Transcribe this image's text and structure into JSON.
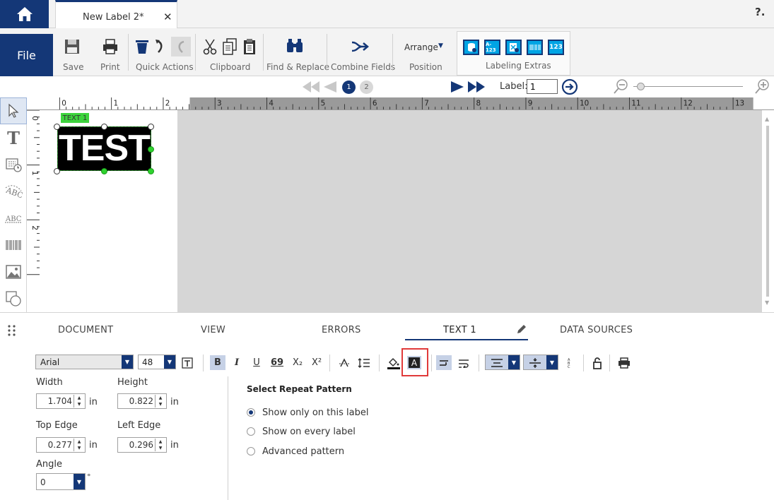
{
  "titlebar": {
    "doc_tab": "New Label 2*",
    "close": "✕",
    "help": "?."
  },
  "ribbon": {
    "file": "File",
    "save": "Save",
    "print": "Print",
    "quick_actions": "Quick Actions",
    "clipboard": "Clipboard",
    "find_replace": "Find & Replace",
    "combine_fields": "Combine Fields",
    "arrange": "Arrange",
    "position": "Position",
    "labeling_extras": "Labeling Extras",
    "extras": [
      "A-123",
      "123"
    ]
  },
  "nav": {
    "pages": [
      "1",
      "2"
    ],
    "label_caption": "Label:",
    "label_value": "1"
  },
  "ruler": {
    "top": [
      "0",
      "1",
      "2",
      "3",
      "4",
      "5",
      "6",
      "7",
      "8",
      "9",
      "10",
      "11",
      "12",
      "13"
    ],
    "left": [
      "0",
      "1",
      "2"
    ]
  },
  "object": {
    "tag": "TEXT 1",
    "text": "TEST"
  },
  "tabs": {
    "document": "DOCUMENT",
    "view": "VIEW",
    "errors": "ERRORS",
    "text1": "TEXT 1",
    "data_sources": "DATA SOURCES"
  },
  "format": {
    "font": "Arial",
    "size": "48",
    "bold": "B",
    "italic": "I",
    "underline": "U",
    "sixnine": "69",
    "sub": "X₂",
    "sup": "X²",
    "inverse": "A"
  },
  "fields": {
    "width_label": "Width",
    "width": "1.704",
    "height_label": "Height",
    "height": "0.822",
    "top_label": "Top Edge",
    "top": "0.277",
    "left_label": "Left Edge",
    "left": "0.296",
    "angle_label": "Angle",
    "angle": "0",
    "unit": "in",
    "deg": "°"
  },
  "repeat": {
    "title": "Select Repeat Pattern",
    "options": [
      "Show only on this label",
      "Show on every label",
      "Advanced pattern"
    ],
    "selected": 0
  },
  "colors": {
    "brand": "#143777",
    "selection": "#3cd43c",
    "highlight": "#e03a3a"
  }
}
